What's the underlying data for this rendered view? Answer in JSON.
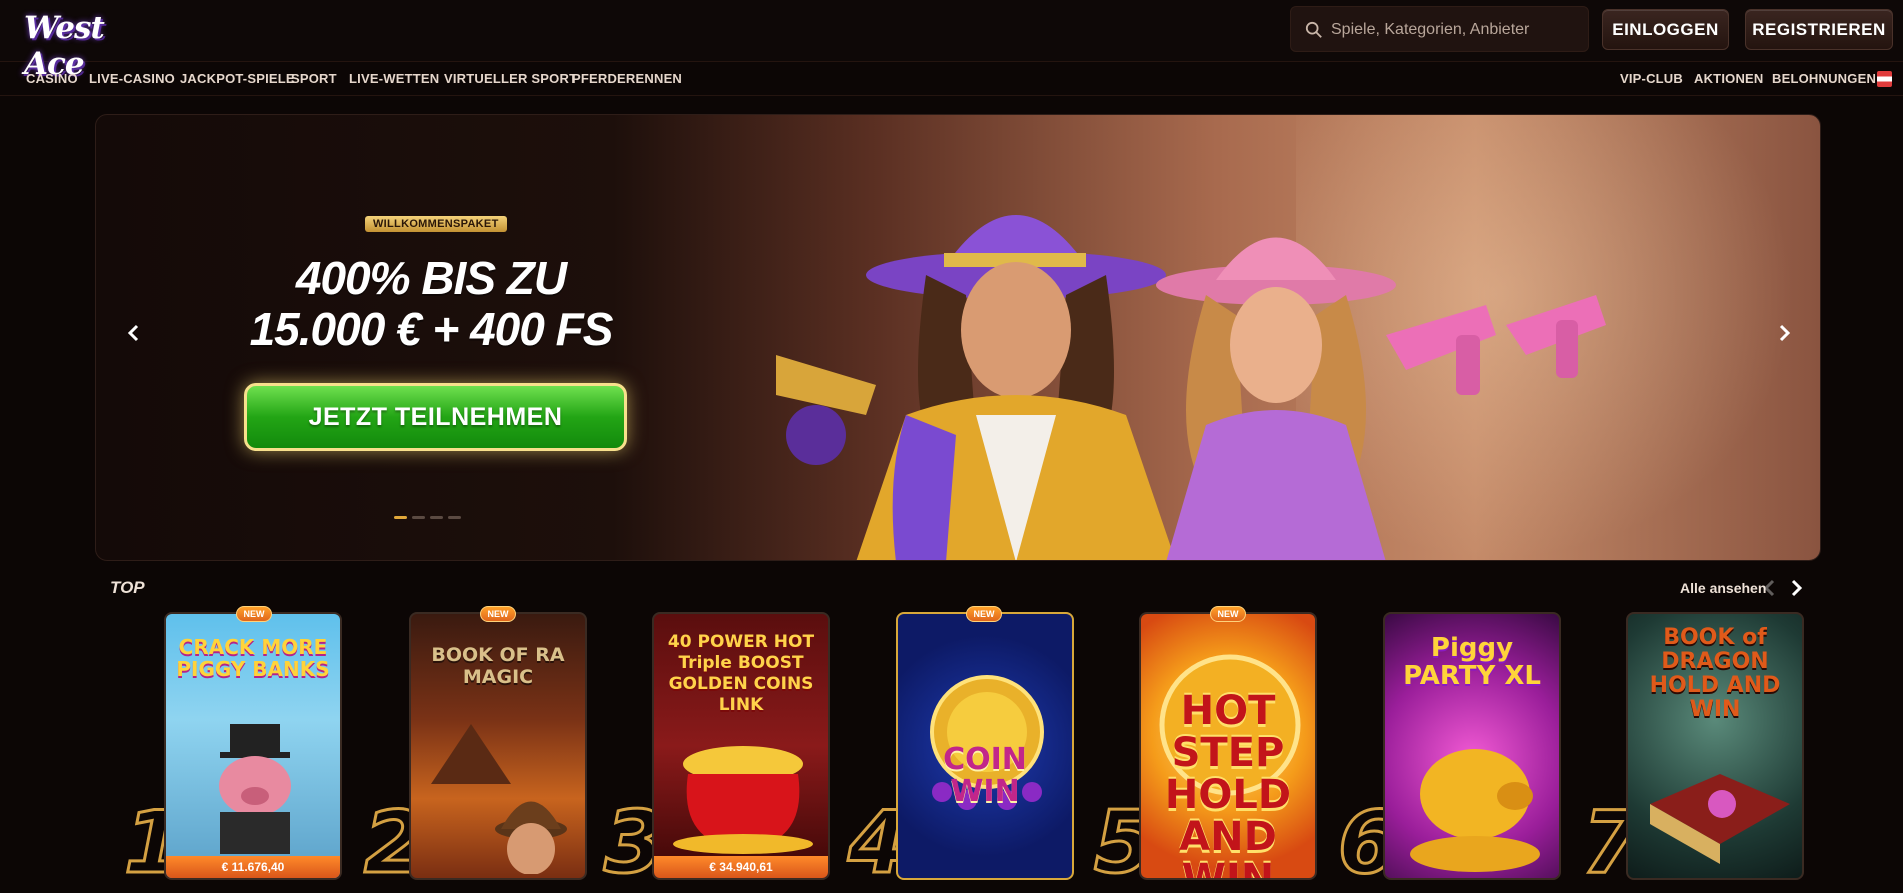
{
  "header": {
    "logo_text": "West Ace",
    "search_placeholder": "Spiele, Kategorien, Anbieter",
    "login_label": "EINLOGGEN",
    "register_label": "REGISTRIEREN"
  },
  "nav": {
    "left": [
      "CASINO",
      "LIVE-CASINO",
      "JACKPOT-SPIELE",
      "SPORT",
      "LIVE-WETTEN",
      "VIRTUELLER SPORT",
      "PFERDERENNEN"
    ],
    "right": [
      "VIP-CLUB",
      "AKTIONEN",
      "BELOHNUNGEN"
    ]
  },
  "banner": {
    "badge": "WILLKOMMENSPAKET",
    "headline_line1": "400% BIS ZU",
    "headline_line2": "15.000 € + 400 FS",
    "cta_label": "JETZT TEILNEHMEN",
    "slides_total": 4,
    "active_slide": 1
  },
  "top_section": {
    "title": "TOP",
    "see_all_label": "Alle ansehen",
    "new_tag": "NEW",
    "games": [
      {
        "rank": "1",
        "title": "CRACK MORE PIGGY BANKS",
        "jackpot": "€ 11.676,40",
        "is_new": true
      },
      {
        "rank": "2",
        "title": "BOOK OF RA MAGIC",
        "jackpot": "",
        "is_new": true
      },
      {
        "rank": "3",
        "title": "40 POWER HOT Triple BOOST GOLDEN COINS LINK",
        "jackpot": "€ 34.940,61",
        "is_new": false
      },
      {
        "rank": "4",
        "title": "COIN WIN",
        "jackpot": "",
        "is_new": true
      },
      {
        "rank": "5",
        "title": "HOT STEP HOLD AND WIN",
        "jackpot": "",
        "is_new": true
      },
      {
        "rank": "6",
        "title": "Piggy PARTY XL",
        "jackpot": "",
        "is_new": false
      },
      {
        "rank": "7",
        "title": "BOOK of DRAGON HOLD AND WIN",
        "jackpot": "",
        "is_new": false
      }
    ]
  },
  "colors": {
    "background": "#0c0605",
    "accent_gold": "#d4a042",
    "cta_green": "#23a515",
    "jackpot_orange": "#e0661c"
  }
}
